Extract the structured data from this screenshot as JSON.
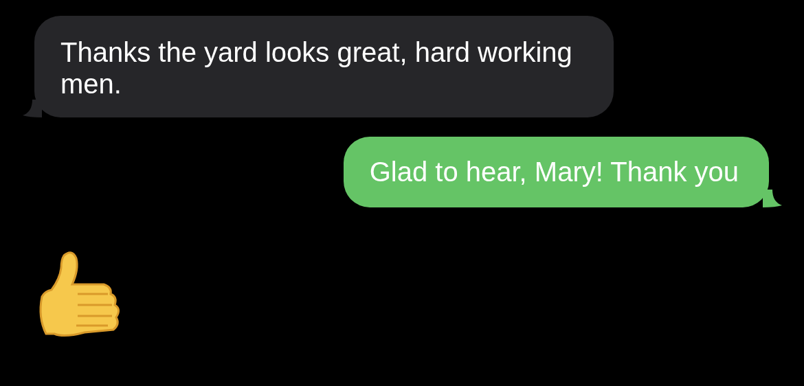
{
  "messages": [
    {
      "kind": "received",
      "text": "Thanks the yard looks great, hard working men."
    },
    {
      "kind": "sent",
      "text": "Glad to hear, Mary! Thank you"
    },
    {
      "kind": "thumbs-up"
    }
  ]
}
